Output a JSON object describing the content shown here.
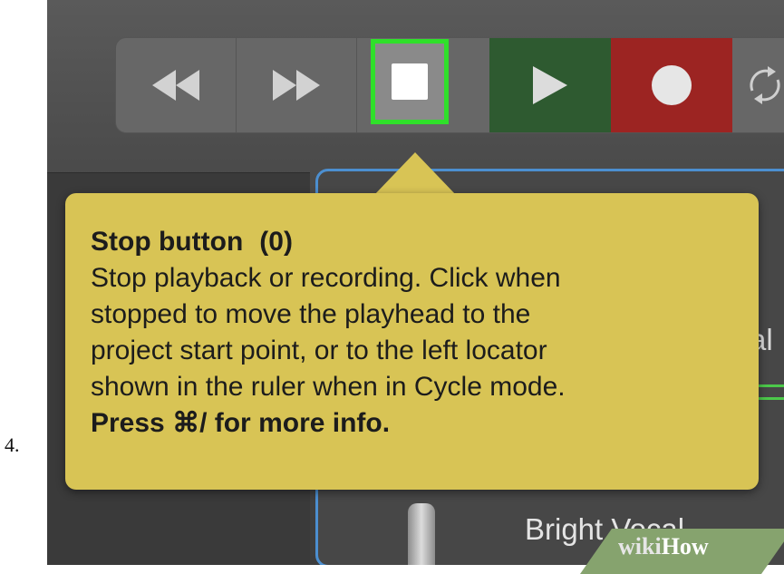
{
  "step": {
    "number": "4."
  },
  "transport": {
    "buttons": [
      {
        "name": "rewind",
        "icon": "rewind-icon"
      },
      {
        "name": "forward",
        "icon": "fast-forward-icon"
      },
      {
        "name": "stop",
        "icon": "stop-icon",
        "highlighted": true,
        "highlight_color": "#2fe02a"
      },
      {
        "name": "play",
        "icon": "play-icon",
        "color": "#2e5a30"
      },
      {
        "name": "record",
        "icon": "record-icon",
        "color": "#9c2422"
      },
      {
        "name": "cycle",
        "icon": "cycle-icon"
      }
    ]
  },
  "tooltip": {
    "title": "Stop button",
    "shortcut": "(0)",
    "lines": [
      "Stop playback or recording. Click when",
      "stopped to move the playhead to the",
      "project start point, or to the left locator",
      "shown in the ruler when in Cycle mode."
    ],
    "footer": "Press ⌘/ for more info.",
    "color": "#d8c455"
  },
  "track": {
    "name": "Bright Vocal",
    "partial_label": "al"
  },
  "watermark": {
    "wiki": "wiki",
    "how": "How"
  }
}
